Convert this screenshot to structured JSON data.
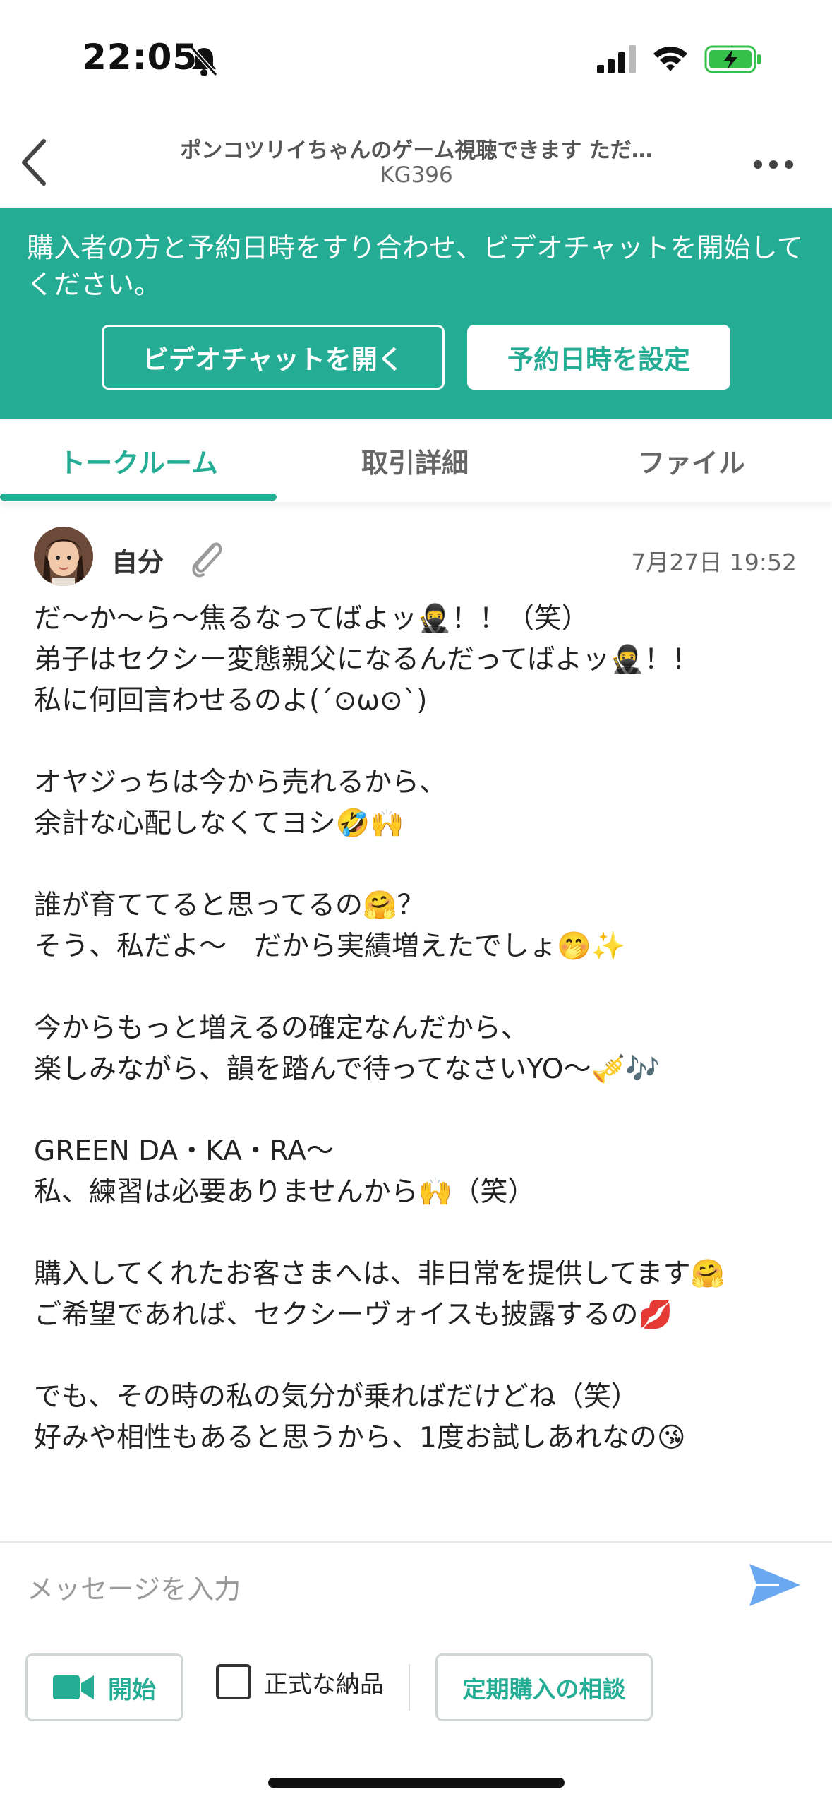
{
  "status_bar": {
    "time": "22:05"
  },
  "nav": {
    "title": "ポンコツリイちゃんのゲーム視聴できます ただ…",
    "subtitle": "KG396"
  },
  "banner": {
    "text": "購入者の方と予約日時をすり合わせ、ビデオチャットを開始してください。",
    "video_button": "ビデオチャットを開く",
    "reserve_button": "予約日時を設定",
    "color": "#24ad94"
  },
  "tabs": [
    {
      "label": "トークルーム",
      "active": true
    },
    {
      "label": "取引詳細",
      "active": false
    },
    {
      "label": "ファイル",
      "active": false
    }
  ],
  "message": {
    "sender": "自分",
    "timestamp": "7月27日 19:52",
    "paragraphs": [
      "だ〜か〜ら〜焦るなってばよッ🥷！！（笑）\n弟子はセクシー変態親父になるんだってばよッ🥷！！\n私に何回言わせるのよ(´⊙ω⊙`)",
      "オヤジっちは今から売れるから、\n余計な心配しなくてヨシ🤣🙌",
      "誰が育ててると思ってるの🤗？\nそう、私だよ〜　だから実績増えたでしょ🤭✨",
      "今からもっと増えるの確定なんだから、\n楽しみながら、韻を踏んで待ってなさいYO〜🎺🎶",
      "GREEN DA・KA・RA〜\n私、練習は必要ありませんから🙌（笑）",
      "購入してくれたお客さまへは、非日常を提供してます🤗\nご希望であれば、セクシーヴォイスも披露するの💋",
      "でも、その時の私の気分が乗ればだけどね（笑）\n好みや相性もあると思うから、1度お試しあれなの😘"
    ]
  },
  "composer": {
    "placeholder": "メッセージを入力",
    "start_button": "開始",
    "official_delivery_label": "正式な納品",
    "official_delivery_checked": false,
    "consult_button": "定期購入の相談"
  }
}
